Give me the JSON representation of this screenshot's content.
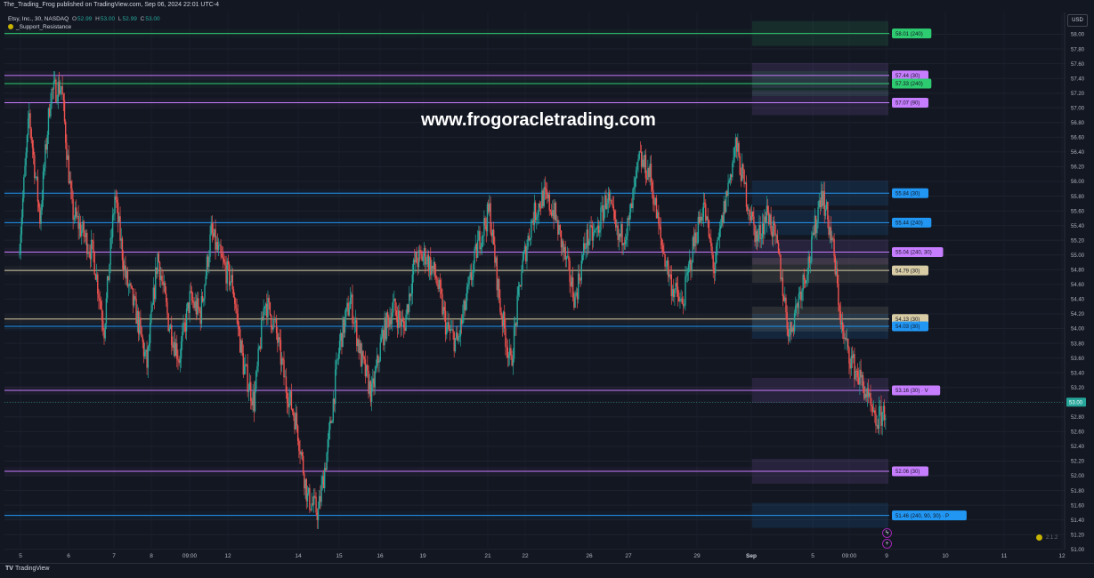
{
  "publisher_line": "The_Trading_Frog published on TradingView.com, Sep 06, 2024 22:01 UTC-4",
  "legend": {
    "symbol": "Etsy, Inc., 30, NASDAQ",
    "open_label": "O",
    "open": "52.99",
    "high_label": "H",
    "high": "53.00",
    "low_label": "L",
    "low": "52.99",
    "close_label": "C",
    "close": "53.00"
  },
  "indicator_name": "_Support_Resistance",
  "watermark": "www.frogoracletrading.com",
  "currency": "USD",
  "footer": {
    "logo_text": "TradingView"
  },
  "version": "2.1.2",
  "colors": {
    "up": "#26a69a",
    "down": "#ef5350",
    "green": "#2ecc71",
    "purple": "#c77dff",
    "blue": "#2196f3",
    "beige": "#d8cca5",
    "price": "#26a69a"
  },
  "chart_data": {
    "type": "candlestick",
    "symbol": "Etsy, Inc., 30, NASDAQ",
    "timeframe": "30",
    "ylim": [
      50.9,
      58.3
    ],
    "y_ticks": [
      "58.00",
      "57.80",
      "57.60",
      "57.40",
      "57.20",
      "57.00",
      "56.80",
      "56.60",
      "56.40",
      "56.20",
      "56.00",
      "55.80",
      "55.60",
      "55.40",
      "55.20",
      "55.00",
      "54.80",
      "54.60",
      "54.40",
      "54.20",
      "54.00",
      "53.80",
      "53.60",
      "53.40",
      "53.20",
      "53.00",
      "52.80",
      "52.60",
      "52.40",
      "52.20",
      "52.00",
      "51.80",
      "51.60",
      "51.40",
      "51.20",
      "51.00"
    ],
    "x_ticks": [
      "5",
      "6",
      "7",
      "8",
      "09:00",
      "12",
      "14",
      "15",
      "16",
      "19",
      "21",
      "22",
      "26",
      "27",
      "29",
      "Sep",
      "5",
      "09:00",
      "9",
      "10",
      "11",
      "12"
    ],
    "x_tick_major": "Sep",
    "last_price": "53.00",
    "levels": [
      {
        "price": 58.01,
        "label": "58.01 (240)",
        "color": "green"
      },
      {
        "price": 57.44,
        "label": "57.44 (30)",
        "color": "purple"
      },
      {
        "price": 57.33,
        "label": "57.33 (240)",
        "color": "green"
      },
      {
        "price": 57.07,
        "label": "57.07 (90)",
        "color": "purple"
      },
      {
        "price": 55.84,
        "label": "55.84 (30)",
        "color": "blue"
      },
      {
        "price": 55.44,
        "label": "55.44 (240)",
        "color": "blue"
      },
      {
        "price": 55.04,
        "label": "55.04 (240, 30)",
        "color": "purple"
      },
      {
        "price": 54.79,
        "label": "54.79 (30)",
        "color": "beige"
      },
      {
        "price": 54.13,
        "label": "54.13 (30)",
        "color": "beige"
      },
      {
        "price": 54.03,
        "label": "54.03 (30)",
        "color": "blue"
      },
      {
        "price": 53.16,
        "label": "53.16 (30) · V",
        "color": "purple"
      },
      {
        "price": 52.06,
        "label": "52.06 (30)",
        "color": "purple"
      },
      {
        "price": 51.46,
        "label": "51.46 (240, 90, 30) · P",
        "color": "blue"
      }
    ],
    "price_path": [
      [
        0,
        55.0
      ],
      [
        1,
        56.9
      ],
      [
        2,
        55.5
      ],
      [
        3,
        57.2
      ],
      [
        4,
        57.3
      ],
      [
        5,
        55.6
      ],
      [
        6,
        55.3
      ],
      [
        7,
        55.0
      ],
      [
        8,
        54.0
      ],
      [
        9,
        55.8
      ],
      [
        10,
        54.7
      ],
      [
        11,
        54.2
      ],
      [
        12,
        53.5
      ],
      [
        13,
        55.0
      ],
      [
        14,
        54.1
      ],
      [
        15,
        53.6
      ],
      [
        16,
        54.4
      ],
      [
        17,
        54.2
      ],
      [
        18,
        55.3
      ],
      [
        19,
        54.9
      ],
      [
        20,
        54.6
      ],
      [
        21,
        53.5
      ],
      [
        22,
        53.0
      ],
      [
        23,
        54.4
      ],
      [
        24,
        54.0
      ],
      [
        25,
        53.2
      ],
      [
        26,
        52.7
      ],
      [
        27,
        51.7
      ],
      [
        28,
        51.5
      ],
      [
        29,
        52.5
      ],
      [
        30,
        53.8
      ],
      [
        31,
        54.4
      ],
      [
        32,
        53.6
      ],
      [
        33,
        53.1
      ],
      [
        34,
        53.9
      ],
      [
        35,
        54.3
      ],
      [
        36,
        54.0
      ],
      [
        37,
        54.9
      ],
      [
        38,
        55.0
      ],
      [
        39,
        54.7
      ],
      [
        40,
        54.0
      ],
      [
        41,
        53.8
      ],
      [
        42,
        54.5
      ],
      [
        43,
        55.2
      ],
      [
        44,
        55.6
      ],
      [
        45,
        54.3
      ],
      [
        46,
        53.5
      ],
      [
        47,
        54.8
      ],
      [
        48,
        55.5
      ],
      [
        49,
        55.8
      ],
      [
        50,
        55.6
      ],
      [
        51,
        55.0
      ],
      [
        52,
        54.4
      ],
      [
        53,
        55.2
      ],
      [
        54,
        55.3
      ],
      [
        55,
        55.8
      ],
      [
        56,
        55.2
      ],
      [
        57,
        55.4
      ],
      [
        58,
        56.3
      ],
      [
        59,
        56.1
      ],
      [
        60,
        55.2
      ],
      [
        61,
        54.6
      ],
      [
        62,
        54.3
      ],
      [
        63,
        55.1
      ],
      [
        64,
        55.7
      ],
      [
        65,
        54.8
      ],
      [
        66,
        55.7
      ],
      [
        67,
        56.5
      ],
      [
        68,
        55.8
      ],
      [
        69,
        55.2
      ],
      [
        70,
        55.6
      ],
      [
        71,
        55.0
      ],
      [
        72,
        53.9
      ],
      [
        73,
        54.5
      ],
      [
        74,
        55.0
      ],
      [
        75,
        55.9
      ],
      [
        76,
        55.2
      ],
      [
        77,
        53.9
      ],
      [
        78,
        53.5
      ],
      [
        79,
        53.2
      ],
      [
        80,
        52.7
      ],
      [
        81,
        52.9
      ]
    ]
  }
}
